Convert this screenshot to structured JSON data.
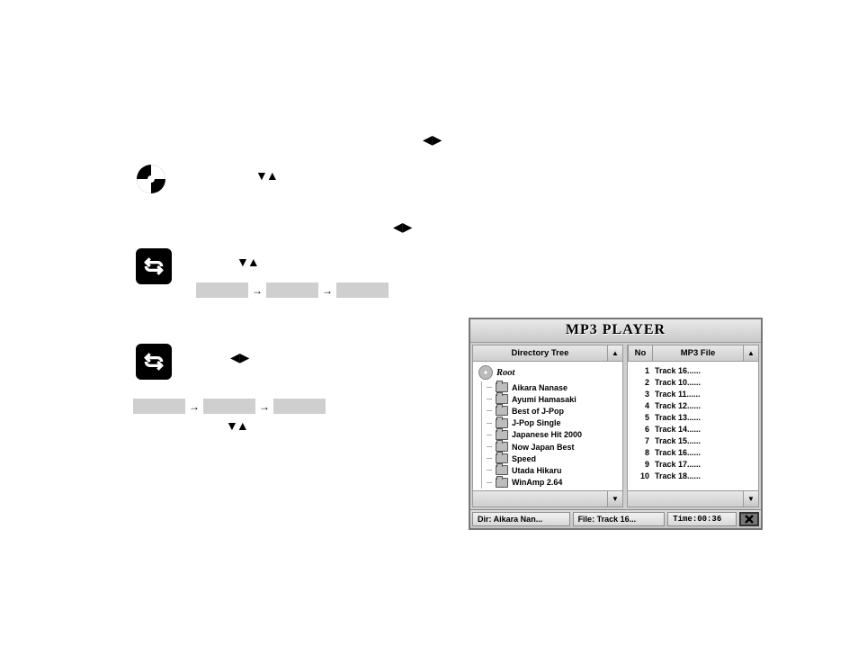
{
  "glyphs": {
    "left_right": "◀ ▶",
    "down_up": "▼▲",
    "seq_arrow": "→"
  },
  "player": {
    "title": "MP3 PLAYER",
    "left_header": "Directory Tree",
    "right_no_header": "No",
    "right_file_header": "MP3 File",
    "root_label": "Root",
    "tree": [
      "Aikara Nanase",
      "Ayumi Hamasaki",
      "Best of J-Pop",
      "J-Pop Single",
      "Japanese Hit 2000",
      "Now Japan Best",
      "Speed",
      "Utada Hikaru",
      "WinAmp 2.64"
    ],
    "tracks": [
      {
        "no": "1",
        "name": "Track 16......"
      },
      {
        "no": "2",
        "name": "Track 10......"
      },
      {
        "no": "3",
        "name": "Track 11......"
      },
      {
        "no": "4",
        "name": "Track 12......"
      },
      {
        "no": "5",
        "name": "Track 13......"
      },
      {
        "no": "6",
        "name": "Track 14......"
      },
      {
        "no": "7",
        "name": "Track 15......"
      },
      {
        "no": "8",
        "name": "Track 16......"
      },
      {
        "no": "9",
        "name": "Track 17......"
      },
      {
        "no": "10",
        "name": "Track 18......"
      }
    ],
    "status": {
      "dir": "Dir: Aikara Nan...",
      "file": "File: Track 16...",
      "time": "Time:00:36"
    },
    "scroll_up": "▲",
    "scroll_down": "▼"
  }
}
